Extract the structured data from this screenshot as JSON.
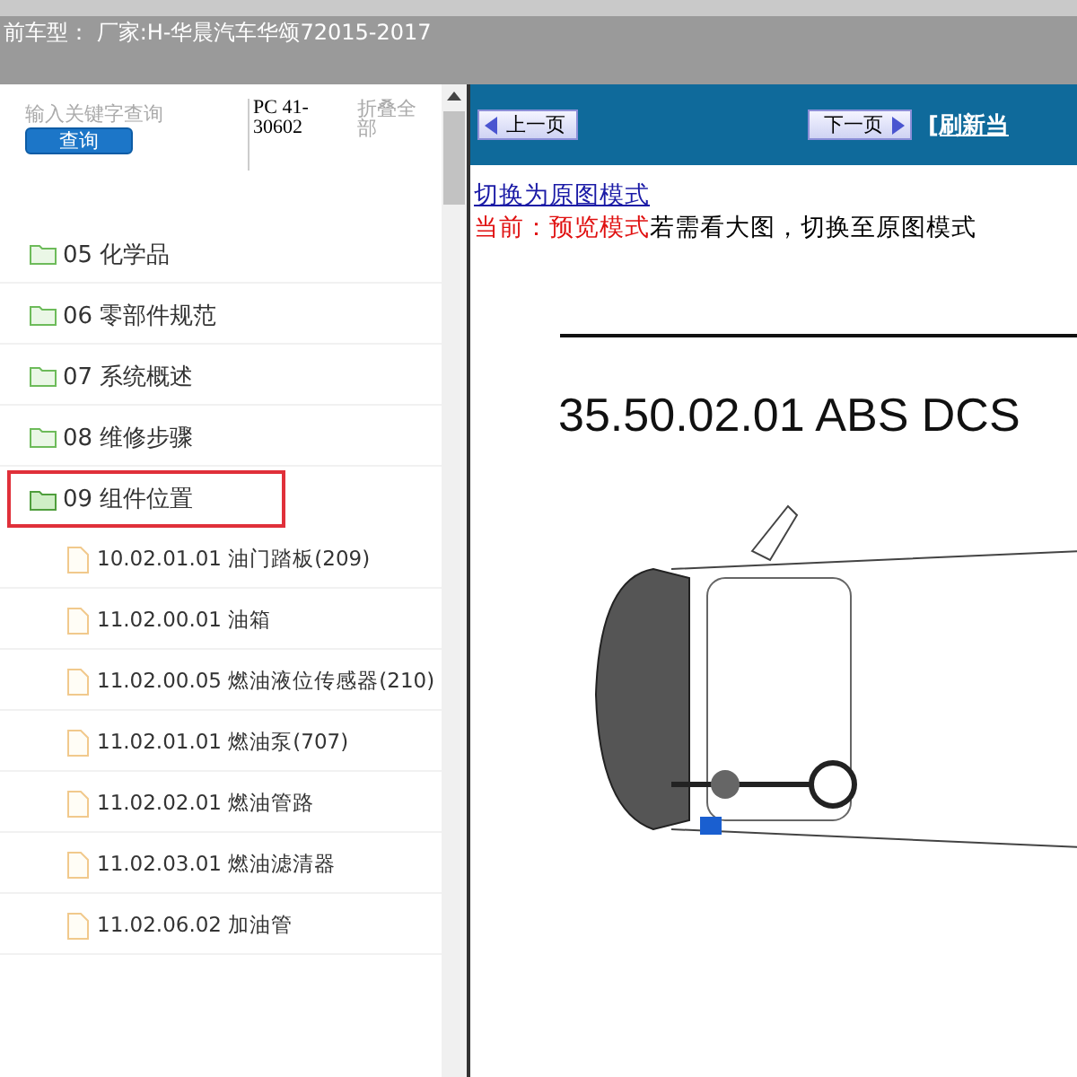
{
  "header": {
    "vehicle": "前车型： 厂家:H-华晨汽车华颂72015-2017"
  },
  "sidebar": {
    "search": {
      "placeholder": "输入关键字查询",
      "button": "查询"
    },
    "code": "PC 41-30602",
    "collapse_all": "折叠全部",
    "tree": [
      {
        "label": "05 化学品",
        "selected": false,
        "expanded": false
      },
      {
        "label": "06 零部件规范",
        "selected": false,
        "expanded": false
      },
      {
        "label": "07 系统概述",
        "selected": false,
        "expanded": false
      },
      {
        "label": "08 维修步骤",
        "selected": false,
        "expanded": false
      },
      {
        "label": "09 组件位置",
        "selected": true,
        "expanded": true,
        "children": [
          {
            "label": "10.02.01.01 油门踏板(209)"
          },
          {
            "label": "11.02.00.01 油箱"
          },
          {
            "label": "11.02.00.05 燃油液位传感器(210)"
          },
          {
            "label": "11.02.01.01 燃油泵(707)"
          },
          {
            "label": "11.02.02.01 燃油管路"
          },
          {
            "label": "11.02.03.01 燃油滤清器"
          },
          {
            "label": "11.02.06.02 加油管"
          }
        ]
      }
    ]
  },
  "viewer": {
    "toolbar": {
      "prev": "上一页",
      "next": "下一页",
      "refresh": "[刷新当"
    },
    "mode_link": "切换为原图模式",
    "status_label": "当前：预览模式",
    "status_message": "若需看大图，切换至原图模式",
    "heading": "35.50.02.01 ABS DCS"
  }
}
